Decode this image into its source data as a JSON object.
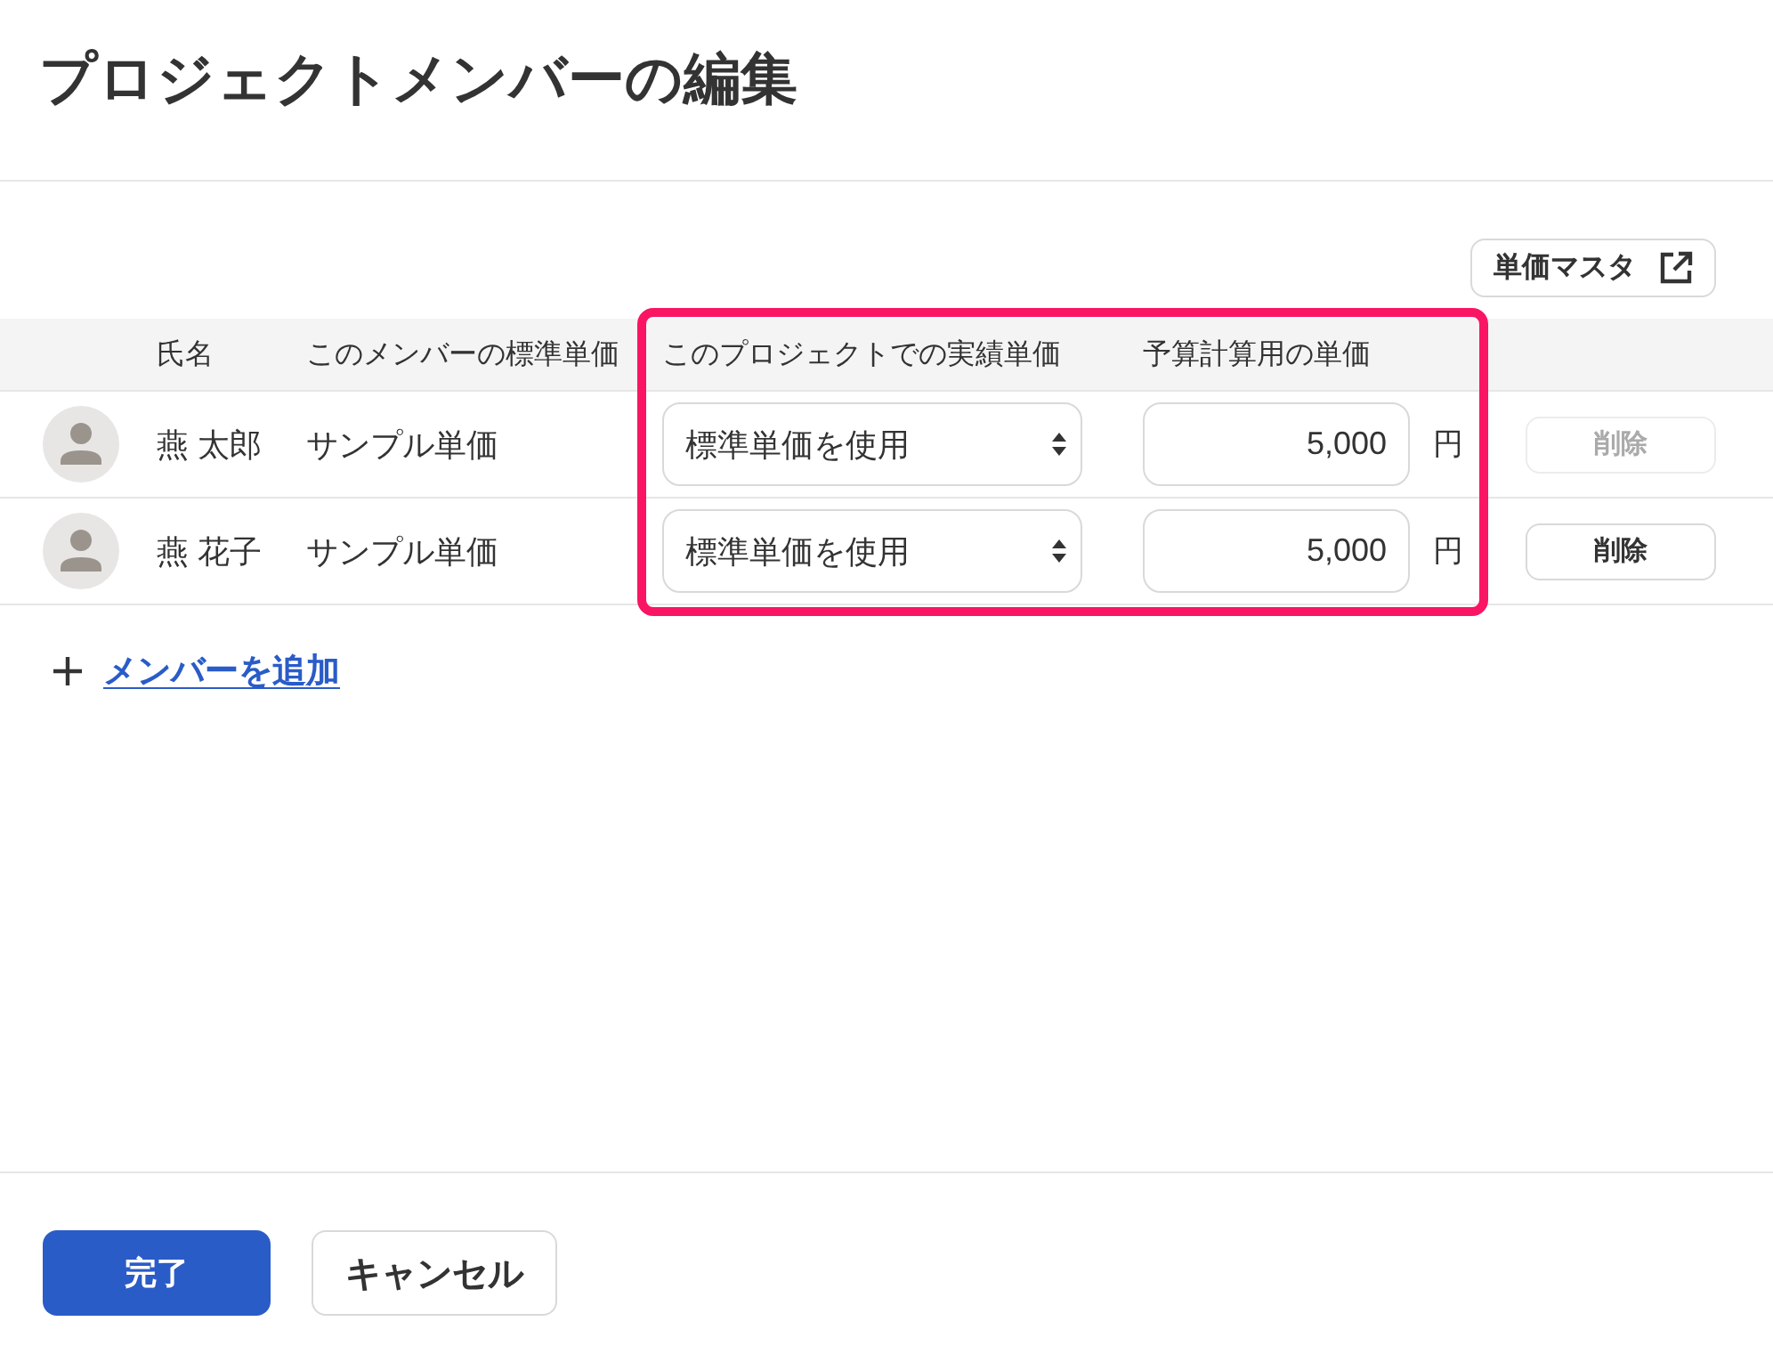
{
  "dialog": {
    "title": "プロジェクトメンバーの編集"
  },
  "toolbar": {
    "rate_master_button": {
      "label": "単価マスタ"
    }
  },
  "table": {
    "column_groups": [
      {
        "kind": "plain",
        "columns": [
          "氏名",
          "このメンバーの標準単価"
        ]
      },
      {
        "kind": "highlighted",
        "columns": [
          "このプロジェクトでの実績単価",
          "予算計算用の単価"
        ]
      }
    ],
    "rows": [
      {
        "name": "燕 太郎",
        "standard_rate": "サンプル単価",
        "actual_rate": "標準単価を使用",
        "budget_rate": "5,000",
        "currency": "円",
        "delete_button": {
          "label": "削除",
          "disabled": true
        }
      },
      {
        "name": "燕 花子",
        "standard_rate": "サンプル単価",
        "actual_rate": "標準単価を使用",
        "budget_rate": "5,000",
        "currency": "円",
        "delete_button": {
          "label": "削除",
          "disabled": false
        }
      }
    ]
  },
  "add_member_link": {
    "label": "メンバーを追加"
  },
  "footer": {
    "buttons": [
      {
        "label": "完了",
        "kind": "primary"
      },
      {
        "label": "キャンセル",
        "kind": "secondary"
      }
    ]
  }
}
